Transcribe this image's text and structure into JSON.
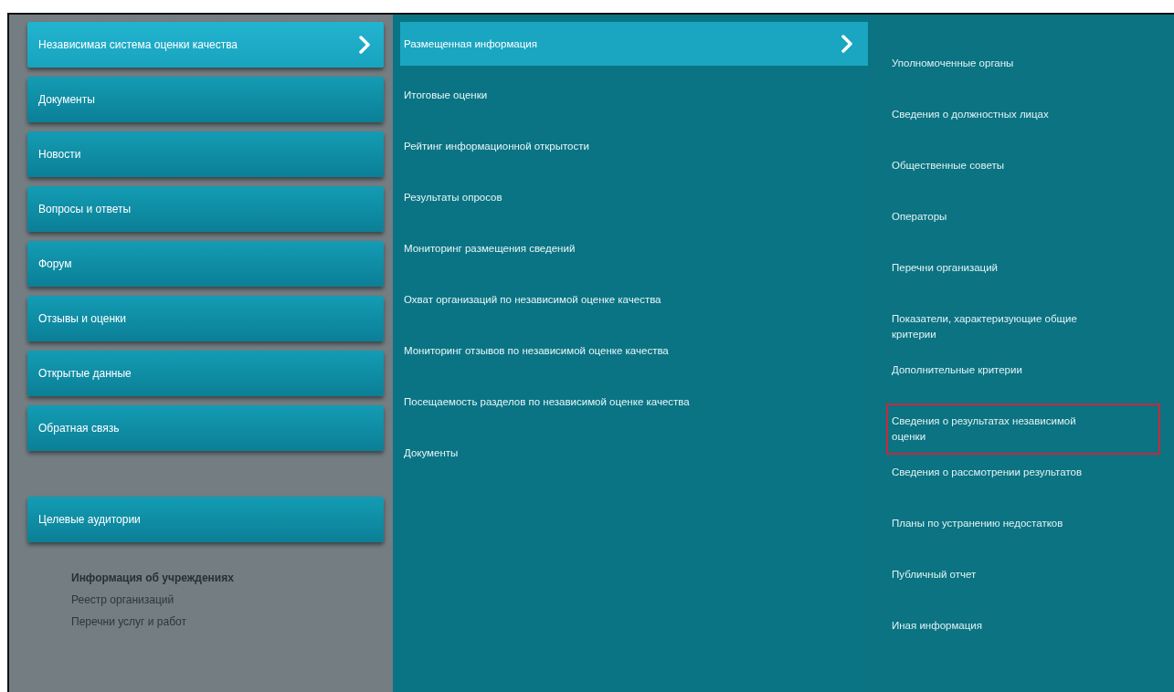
{
  "sidebar": {
    "items": [
      {
        "label": "Независимая система оценки качества",
        "selected": true,
        "has_submenu": true
      },
      {
        "label": "Документы",
        "selected": false,
        "has_submenu": false
      },
      {
        "label": "Новости",
        "selected": false,
        "has_submenu": false
      },
      {
        "label": "Вопросы и ответы",
        "selected": false,
        "has_submenu": false
      },
      {
        "label": "Форум",
        "selected": false,
        "has_submenu": false
      },
      {
        "label": "Отзывы и оценки",
        "selected": false,
        "has_submenu": false
      },
      {
        "label": "Открытые данные",
        "selected": false,
        "has_submenu": false
      },
      {
        "label": "Обратная связь",
        "selected": false,
        "has_submenu": false
      }
    ],
    "audience_button": {
      "label": "Целевые аудитории"
    },
    "links": [
      {
        "label": "Информация об учреждениях",
        "kind": "heading"
      },
      {
        "label": "Реестр организаций",
        "kind": "link"
      },
      {
        "label": "Перечни услуг и работ",
        "kind": "link"
      }
    ]
  },
  "submenu": {
    "items": [
      {
        "label": "Размещенная информация",
        "selected": true,
        "has_submenu": true
      },
      {
        "label": "Итоговые оценки",
        "selected": false,
        "has_submenu": false
      },
      {
        "label": "Рейтинг информационной открытости",
        "selected": false,
        "has_submenu": false
      },
      {
        "label": "Результаты опросов",
        "selected": false,
        "has_submenu": false
      },
      {
        "label": "Мониторинг размещения сведений",
        "selected": false,
        "has_submenu": false
      },
      {
        "label": "Охват организаций по независимой оценке качества",
        "selected": false,
        "has_submenu": false
      },
      {
        "label": "Мониторинг отзывов по независимой оценке качества",
        "selected": false,
        "has_submenu": false
      },
      {
        "label": "Посещаемость разделов по независимой оценке качества",
        "selected": false,
        "has_submenu": false
      },
      {
        "label": "Документы",
        "selected": false,
        "has_submenu": false
      }
    ]
  },
  "subsubmenu": {
    "items": [
      {
        "label": "Уполномоченные органы",
        "highlighted": false
      },
      {
        "label": "Сведения о должностных лицах",
        "highlighted": false
      },
      {
        "label": "Общественные советы",
        "highlighted": false
      },
      {
        "label": "Операторы",
        "highlighted": false
      },
      {
        "label": "Перечни организаций",
        "highlighted": false
      },
      {
        "label": "Показатели, характеризующие общие критерии",
        "highlighted": false
      },
      {
        "label": "Дополнительные критерии",
        "highlighted": false
      },
      {
        "label": "Сведения о результатах независимой оценки",
        "highlighted": true
      },
      {
        "label": "Сведения о рассмотрении результатов",
        "highlighted": false
      },
      {
        "label": "Планы по устранению недостатков",
        "highlighted": false
      },
      {
        "label": "Публичный отчет",
        "highlighted": false
      },
      {
        "label": "Иная информация",
        "highlighted": false
      }
    ]
  }
}
